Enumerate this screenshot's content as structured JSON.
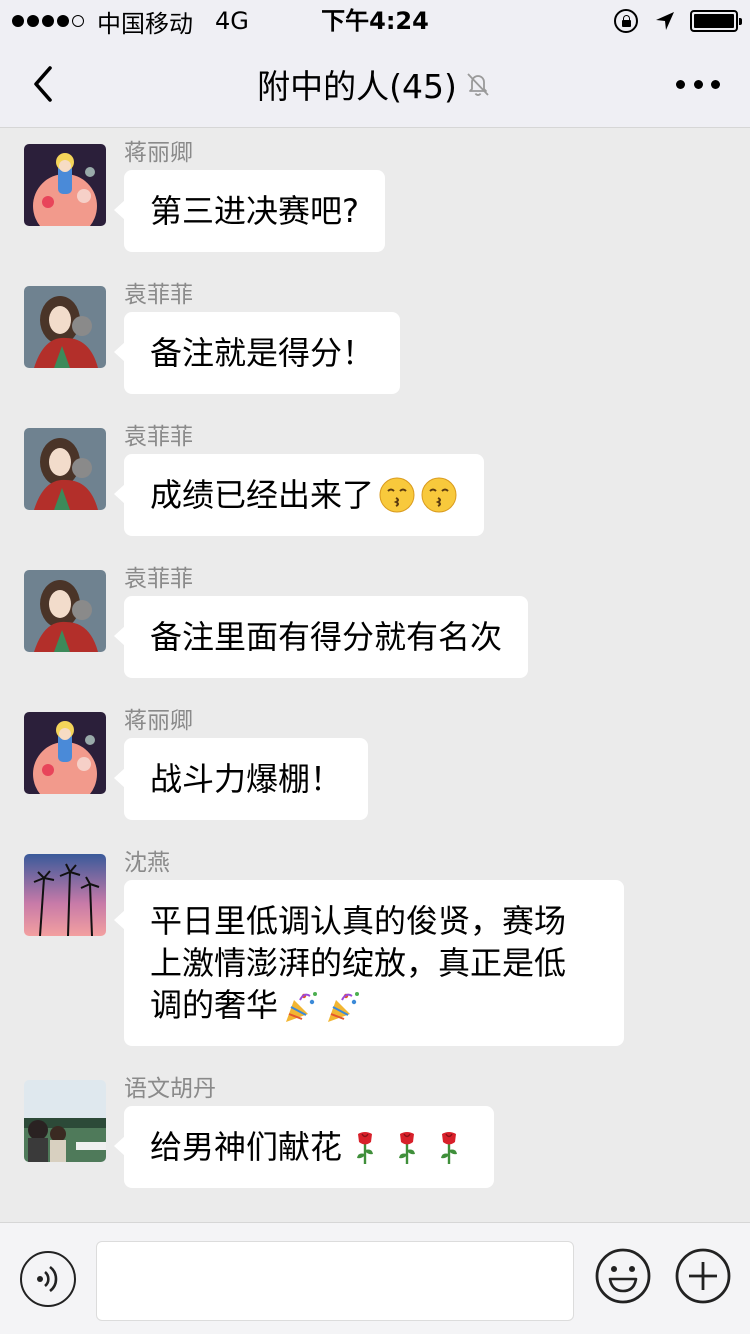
{
  "status_bar": {
    "carrier": "中国移动",
    "network": "4G",
    "time": "下午4:24",
    "signal_bars_filled": 4,
    "signal_bars_total": 5
  },
  "nav": {
    "title": "附中的人(45)",
    "back_icon": "chevron-left-icon",
    "mute_icon": "bell-off-icon",
    "more_icon": "more-dots-icon"
  },
  "messages": [
    {
      "sender": "蒋丽卿",
      "text": "第三进决赛吧?",
      "emoji": []
    },
    {
      "sender": "袁菲菲",
      "text": "备注就是得分！",
      "emoji": []
    },
    {
      "sender": "袁菲菲",
      "text": "成绩已经出来了",
      "emoji": [
        "kissing-face-emoji",
        "kissing-face-emoji"
      ]
    },
    {
      "sender": "袁菲菲",
      "text": "备注里面有得分就有名次",
      "emoji": []
    },
    {
      "sender": "蒋丽卿",
      "text": "战斗力爆棚！",
      "emoji": []
    },
    {
      "sender": "沈燕",
      "lines": [
        "平日里低调认真的俊贤，赛场",
        "上激情澎湃的绽放，真正是低",
        "调的奢华"
      ],
      "emoji": [
        "party-popper-emoji",
        "party-popper-emoji"
      ]
    },
    {
      "sender": "语文胡丹",
      "text": "给男神们献花",
      "emoji": [
        "rose-emoji",
        "rose-emoji",
        "rose-emoji"
      ]
    }
  ],
  "input_bar": {
    "text_value": "",
    "voice_icon": "voice-icon",
    "emoji_icon": "smiley-icon",
    "plus_icon": "plus-icon"
  }
}
